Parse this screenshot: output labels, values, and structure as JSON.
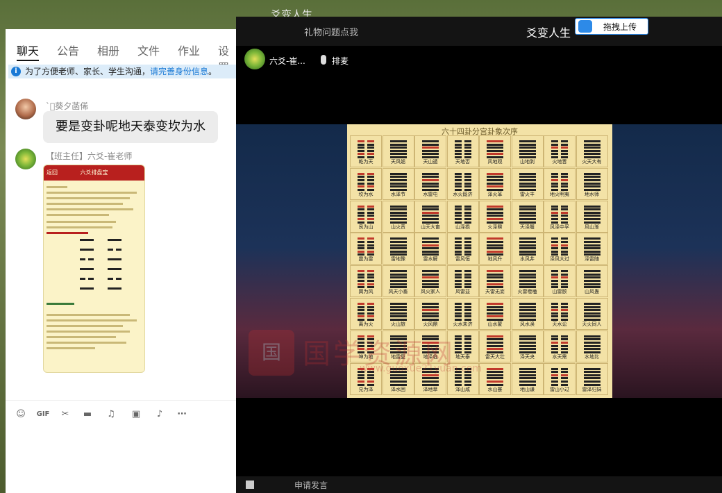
{
  "background_window": {
    "title": "爻变人生"
  },
  "chat": {
    "tabs": [
      "聊天",
      "公告",
      "相册",
      "文件",
      "作业",
      "设置"
    ],
    "active_tab": 0,
    "notice": {
      "text": "为了方便老师、家长、学生沟通，",
      "link": "请完善身份信息",
      "end": "。"
    },
    "messages": [
      {
        "sender": "`ﾞ葵夕菡俙",
        "text": "要是变卦呢地天泰变坎为水"
      },
      {
        "sender": "【班主任】六爻-崔老师",
        "image_app_title": "六爻排盘宝",
        "image_back": "返回"
      }
    ],
    "toolbar": [
      "emoji-icon",
      "gif-icon",
      "scissors-icon",
      "folder-icon",
      "music-icon",
      "image-icon",
      "bell-icon",
      "more-icon"
    ]
  },
  "video": {
    "gift_hint": "礼物问题点我",
    "title": "爻变人生",
    "upload_button": "拖拽上传",
    "host_name": "六爻-崔...",
    "queue_button": "排麦",
    "board_title": "六十四卦分宫卦象次序",
    "hexagrams": [
      "乾为天",
      "天风姤",
      "天山遁",
      "天地否",
      "风地观",
      "山地剥",
      "火地晋",
      "火天大有",
      "坎为水",
      "水泽节",
      "水雷屯",
      "水火既济",
      "泽火革",
      "雷火丰",
      "地火明夷",
      "地水师",
      "艮为山",
      "山火贲",
      "山天大畜",
      "山泽损",
      "火泽睽",
      "天泽履",
      "风泽中孚",
      "风山渐",
      "震为雷",
      "雷地豫",
      "雷水解",
      "雷风恒",
      "地风升",
      "水风井",
      "泽风大过",
      "泽雷随",
      "巽为风",
      "风天小畜",
      "风火家人",
      "风雷益",
      "天雷无妄",
      "火雷噬嗑",
      "山雷颐",
      "山风蛊",
      "离为火",
      "火山旅",
      "火风鼎",
      "火水未济",
      "山水蒙",
      "风水涣",
      "天水讼",
      "天火同人",
      "坤为地",
      "地雷复",
      "地泽临",
      "地天泰",
      "雷天大壮",
      "泽天夬",
      "水天需",
      "水地比",
      "兑为泽",
      "泽水困",
      "泽地萃",
      "泽山咸",
      "水山蹇",
      "地山谦",
      "雷山小过",
      "雷泽归妹"
    ],
    "watermark": {
      "logo": "国",
      "text": "国学资源网",
      "url": "www.guoxue21yuan.com"
    },
    "apply_button": "申请发言"
  },
  "colors": {
    "accent": "#2d8ae8",
    "bubble": "#ececec",
    "board": "#f3e2a6",
    "red": "#b8201e"
  }
}
